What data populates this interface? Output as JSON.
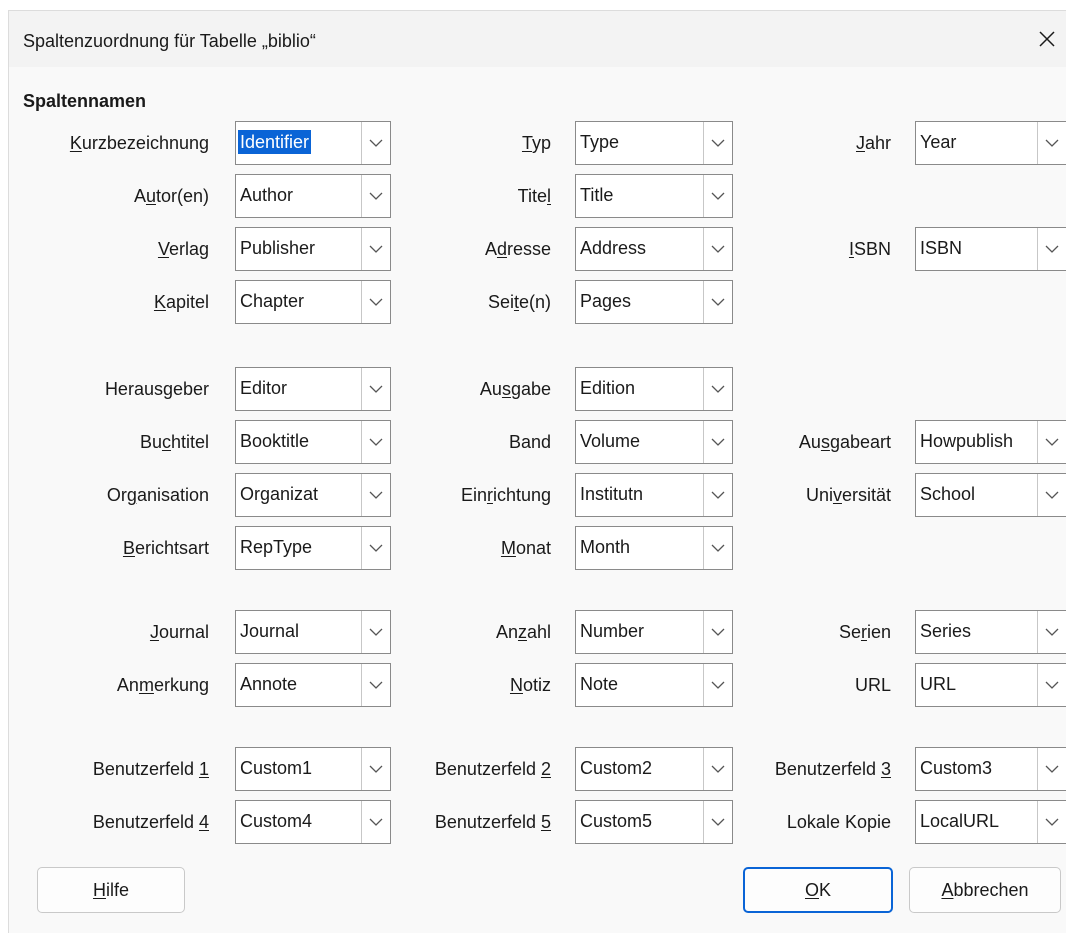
{
  "window": {
    "title": "Spaltenzuordnung für Tabelle „biblio“"
  },
  "section_heading": "Spaltennamen",
  "rows": [
    [
      {
        "label_pre": "",
        "label_mn": "K",
        "label_post": "urzbezeichnung",
        "value": "Identifier",
        "selected": true
      },
      {
        "label_pre": "",
        "label_mn": "T",
        "label_post": "yp",
        "value": "Type"
      },
      {
        "label_pre": "",
        "label_mn": "J",
        "label_post": "ahr",
        "value": "Year"
      }
    ],
    [
      {
        "label_pre": "A",
        "label_mn": "u",
        "label_post": "tor(en)",
        "value": "Author"
      },
      {
        "label_pre": "Tite",
        "label_mn": "l",
        "label_post": "",
        "value": "Title"
      },
      null
    ],
    [
      {
        "label_pre": "",
        "label_mn": "V",
        "label_post": "erlag",
        "value": "Publisher"
      },
      {
        "label_pre": "A",
        "label_mn": "d",
        "label_post": "resse",
        "value": "Address"
      },
      {
        "label_pre": "",
        "label_mn": "I",
        "label_post": "SBN",
        "value": "ISBN"
      }
    ],
    [
      {
        "label_pre": "",
        "label_mn": "K",
        "label_post": "apitel",
        "value": "Chapter"
      },
      {
        "label_pre": "Sei",
        "label_mn": "t",
        "label_post": "e(n)",
        "value": "Pages"
      },
      null
    ],
    [
      {
        "label_pre": "Herausgeber",
        "label_mn": "",
        "label_post": "",
        "value": "Editor"
      },
      {
        "label_pre": "Au",
        "label_mn": "s",
        "label_post": "gabe",
        "value": "Edition"
      },
      null
    ],
    [
      {
        "label_pre": "Bu",
        "label_mn": "c",
        "label_post": "htitel",
        "value": "Booktitle"
      },
      {
        "label_pre": "Band",
        "label_mn": "",
        "label_post": "",
        "value": "Volume"
      },
      {
        "label_pre": "Au",
        "label_mn": "s",
        "label_post": "gabeart",
        "value": "Howpublish"
      }
    ],
    [
      {
        "label_pre": "Or",
        "label_mn": "g",
        "label_post": "anisation",
        "value": "Organizat"
      },
      {
        "label_pre": "Ein",
        "label_mn": "r",
        "label_post": "ichtung",
        "value": "Institutn"
      },
      {
        "label_pre": "Uni",
        "label_mn": "v",
        "label_post": "ersität",
        "value": "School"
      }
    ],
    [
      {
        "label_pre": "",
        "label_mn": "B",
        "label_post": "erichtsart",
        "value": "RepType"
      },
      {
        "label_pre": "",
        "label_mn": "M",
        "label_post": "onat",
        "value": "Month"
      },
      null
    ],
    [
      {
        "label_pre": "",
        "label_mn": "J",
        "label_post": "ournal",
        "value": "Journal"
      },
      {
        "label_pre": "An",
        "label_mn": "z",
        "label_post": "ahl",
        "value": "Number"
      },
      {
        "label_pre": "Se",
        "label_mn": "r",
        "label_post": "ien",
        "value": "Series"
      }
    ],
    [
      {
        "label_pre": "An",
        "label_mn": "m",
        "label_post": "erkung",
        "value": "Annote"
      },
      {
        "label_pre": "",
        "label_mn": "N",
        "label_post": "otiz",
        "value": "Note"
      },
      {
        "label_pre": "URL",
        "label_mn": "",
        "label_post": "",
        "value": "URL"
      }
    ],
    [
      {
        "label_pre": "Benutzerfeld ",
        "label_mn": "1",
        "label_post": "",
        "value": "Custom1"
      },
      {
        "label_pre": "Benutzerfeld ",
        "label_mn": "2",
        "label_post": "",
        "value": "Custom2"
      },
      {
        "label_pre": "Benutzerfeld ",
        "label_mn": "3",
        "label_post": "",
        "value": "Custom3"
      }
    ],
    [
      {
        "label_pre": "Benutzerfeld ",
        "label_mn": "4",
        "label_post": "",
        "value": "Custom4"
      },
      {
        "label_pre": "Benutzerfeld ",
        "label_mn": "5",
        "label_post": "",
        "value": "Custom5"
      },
      {
        "label_pre": "Lokale Kopie",
        "label_mn": "",
        "label_post": "",
        "value": "LocalURL"
      }
    ]
  ],
  "buttons": {
    "help": {
      "label_pre": "",
      "label_mn": "H",
      "label_post": "ilfe"
    },
    "ok": {
      "label_pre": "",
      "label_mn": "O",
      "label_post": "K"
    },
    "cancel": {
      "label_pre": "",
      "label_mn": "A",
      "label_post": "bbrechen"
    }
  },
  "colors": {
    "selection": "#0a64d6",
    "default_button_border": "#0a64d6"
  },
  "icons": {
    "close": "close-icon",
    "dropdown": "chevron-down-icon"
  }
}
